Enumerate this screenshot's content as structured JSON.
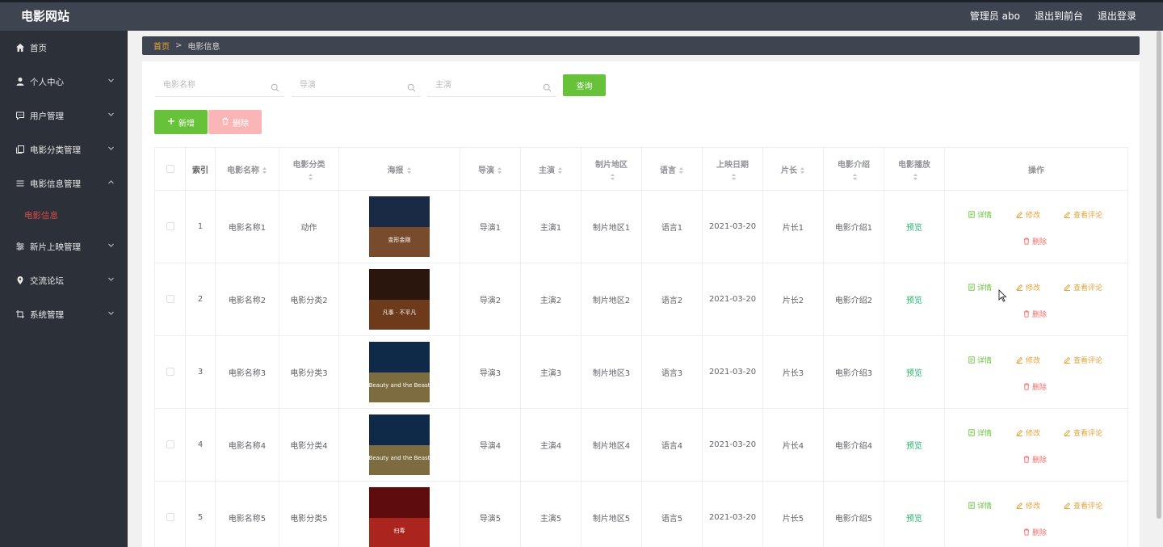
{
  "header": {
    "brand": "电影网站",
    "links": [
      "管理员 abo",
      "退出到前台",
      "退出登录"
    ]
  },
  "sidebar": {
    "items": [
      {
        "label": "首页",
        "icon": "home-icon",
        "expandable": false
      },
      {
        "label": "个人中心",
        "icon": "user-icon",
        "expandable": true
      },
      {
        "label": "用户管理",
        "icon": "chat-icon",
        "expandable": true
      },
      {
        "label": "电影分类管理",
        "icon": "copy-icon",
        "expandable": true
      },
      {
        "label": "电影信息管理",
        "icon": "list-icon",
        "expandable": true,
        "expanded": true
      },
      {
        "label": "新片上映管理",
        "icon": "sliders-icon",
        "expandable": true
      },
      {
        "label": "交流论坛",
        "icon": "location-icon",
        "expandable": true
      },
      {
        "label": "系统管理",
        "icon": "crop-icon",
        "expandable": true
      }
    ],
    "active_sub": "电影信息"
  },
  "breadcrumb": {
    "home": "首页",
    "separator": ">",
    "current": "电影信息"
  },
  "search": {
    "name_placeholder": "电影名称",
    "director_placeholder": "导演",
    "actor_placeholder": "主演",
    "query_label": "查询"
  },
  "toolbar": {
    "add_label": "新增",
    "delete_label": "删除"
  },
  "table": {
    "columns": [
      "索引",
      "电影名称",
      "电影分类",
      "海报",
      "导演",
      "主演",
      "制片地区",
      "语言",
      "上映日期",
      "片长",
      "电影介绍",
      "电影播放",
      "操作"
    ],
    "rows": [
      {
        "index": "1",
        "name": "电影名称1",
        "category": "动作",
        "director": "导演1",
        "actor": "主演1",
        "region": "制片地区1",
        "language": "语言1",
        "date": "2021-03-20",
        "length": "片长1",
        "intro": "电影介绍1",
        "play": "预览"
      },
      {
        "index": "2",
        "name": "电影名称2",
        "category": "电影分类2",
        "director": "导演2",
        "actor": "主演2",
        "region": "制片地区2",
        "language": "语言2",
        "date": "2021-03-20",
        "length": "片长2",
        "intro": "电影介绍2",
        "play": "预览"
      },
      {
        "index": "3",
        "name": "电影名称3",
        "category": "电影分类3",
        "director": "导演3",
        "actor": "主演3",
        "region": "制片地区3",
        "language": "语言3",
        "date": "2021-03-20",
        "length": "片长3",
        "intro": "电影介绍3",
        "play": "预览"
      },
      {
        "index": "4",
        "name": "电影名称4",
        "category": "电影分类4",
        "director": "导演4",
        "actor": "主演4",
        "region": "制片地区4",
        "language": "语言4",
        "date": "2021-03-20",
        "length": "片长4",
        "intro": "电影介绍4",
        "play": "预览"
      },
      {
        "index": "5",
        "name": "电影名称5",
        "category": "电影分类5",
        "director": "导演5",
        "actor": "主演5",
        "region": "制片地区5",
        "language": "语言5",
        "date": "2021-03-20",
        "length": "片长5",
        "intro": "电影介绍5",
        "play": "预览"
      }
    ],
    "posters": [
      {
        "poster_text": "变形金刚",
        "colors": [
          "#1a2a44",
          "#c9661c"
        ]
      },
      {
        "poster_text": "凡事 · 不平凡",
        "colors": [
          "#2a160c",
          "#a55a2a"
        ]
      },
      {
        "poster_text": "Beauty and the Beast",
        "colors": [
          "#0f2a48",
          "#d8a23a"
        ]
      },
      {
        "poster_text": "Beauty and the Beast",
        "colors": [
          "#0f2a48",
          "#d8a23a"
        ]
      },
      {
        "poster_text": "扫毒",
        "colors": [
          "#5e0c0c",
          "#e83a2c"
        ]
      }
    ],
    "actions": {
      "detail": "详情",
      "edit": "修改",
      "review": "查看评论",
      "delete": "删除"
    }
  },
  "colors": {
    "topbar": "#3e4551",
    "sidebar": "#2c3139",
    "accent_green": "#67c23a",
    "accent_orange": "#e6a23c",
    "danger_red": "#f56c6c",
    "active_menu": "#e04847"
  }
}
